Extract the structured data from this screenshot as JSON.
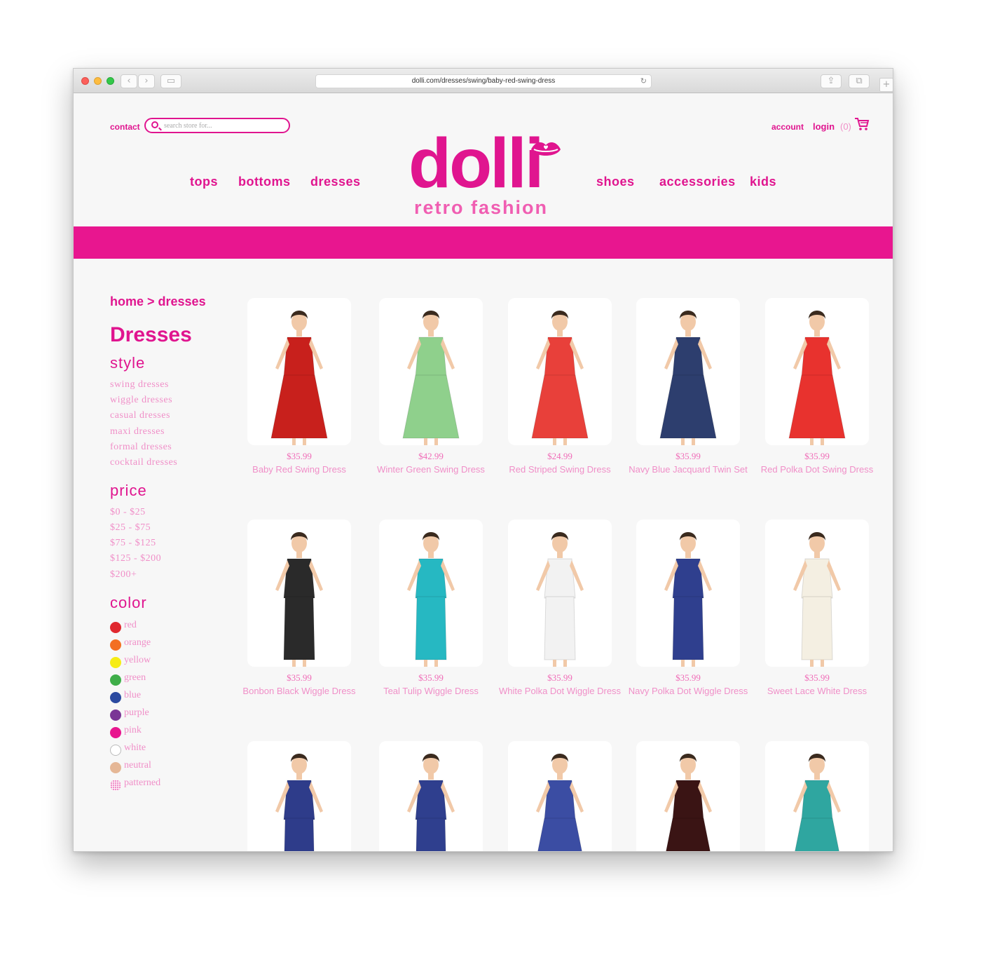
{
  "browser": {
    "url": "dolli.com/dresses/swing/baby-red-swing-dress"
  },
  "header": {
    "contact": "contact",
    "search_placeholder": "search store for...",
    "account": "account",
    "login": "login",
    "cart_count": "(0)"
  },
  "logo": {
    "word": "dolli",
    "tagline": "retro fashion"
  },
  "nav": {
    "tops": "tops",
    "bottoms": "bottoms",
    "dresses": "dresses",
    "shoes": "shoes",
    "accessories": "accessories",
    "kids": "kids"
  },
  "breadcrumb": "home > dresses",
  "page_title": "Dresses",
  "filters": {
    "style_heading": "style",
    "style": [
      "swing dresses",
      "wiggle dresses",
      "casual dresses",
      "maxi dresses",
      "formal dresses",
      "cocktail dresses"
    ],
    "price_heading": "price",
    "price": [
      "$0 - $25",
      "$25 - $75",
      "$75 - $125",
      "$125 - $200",
      "$200+"
    ],
    "color_heading": "color",
    "colors": [
      {
        "label": "red",
        "color": "#e0282f"
      },
      {
        "label": "orange",
        "color": "#f36f22"
      },
      {
        "label": "yellow",
        "color": "#f6ec14"
      },
      {
        "label": "green",
        "color": "#3fae49"
      },
      {
        "label": "blue",
        "color": "#2b4aa0"
      },
      {
        "label": "purple",
        "color": "#7a3595"
      },
      {
        "label": "pink",
        "color": "#e8168f"
      },
      {
        "label": "white",
        "color": "#ffffff"
      },
      {
        "label": "neutral",
        "color": "#e5b796"
      },
      {
        "label": "patterned",
        "color": "#f08fc8"
      }
    ]
  },
  "products": [
    {
      "price": "$35.99",
      "name": "Baby Red Swing Dress",
      "dress_color": "#c8201c"
    },
    {
      "price": "$42.99",
      "name": "Winter Green Swing Dress",
      "dress_color": "#8fd08c"
    },
    {
      "price": "$24.99",
      "name": "Red Striped Swing Dress",
      "dress_color": "#e8403a"
    },
    {
      "price": "$35.99",
      "name": "Navy Blue Jacquard Twin Set",
      "dress_color": "#2d3e6e"
    },
    {
      "price": "$35.99",
      "name": "Red Polka Dot Swing Dress",
      "dress_color": "#e8322e"
    },
    {
      "price": "$35.99",
      "name": "Bonbon Black Wiggle Dress",
      "dress_color": "#2a2a2a"
    },
    {
      "price": "$35.99",
      "name": "Teal Tulip Wiggle Dress",
      "dress_color": "#26b8c2"
    },
    {
      "price": "$35.99",
      "name": "White Polka Dot Wiggle Dress",
      "dress_color": "#f2f2f2"
    },
    {
      "price": "$35.99",
      "name": "Navy Polka Dot Wiggle Dress",
      "dress_color": "#2f3f8e"
    },
    {
      "price": "$35.99",
      "name": "Sweet Lace White Dress",
      "dress_color": "#f4efe2"
    },
    {
      "price": "",
      "name": "",
      "dress_color": "#2e3c8a"
    },
    {
      "price": "",
      "name": "",
      "dress_color": "#2f3f8e"
    },
    {
      "price": "",
      "name": "",
      "dress_color": "#3b4da3"
    },
    {
      "price": "",
      "name": "",
      "dress_color": "#3a1414"
    },
    {
      "price": "",
      "name": "",
      "dress_color": "#2fa6a0"
    }
  ]
}
